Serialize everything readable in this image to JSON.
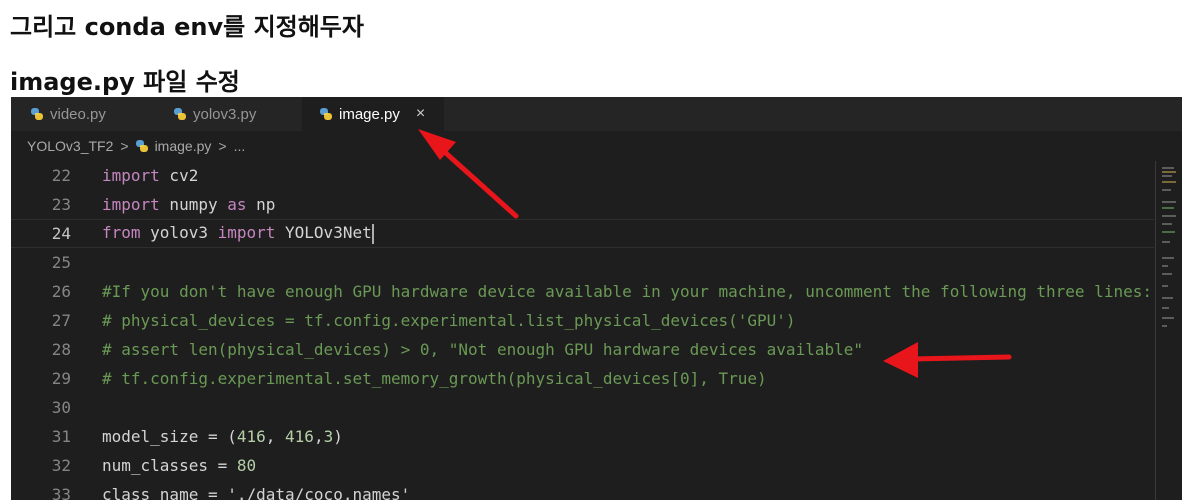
{
  "headings": {
    "first": "그리고 conda env를 지정해두자",
    "second": "image.py 파일 수정"
  },
  "editor": {
    "tabs": [
      {
        "label": "video.py",
        "active": false,
        "icon": "python-file-icon"
      },
      {
        "label": "yolov3.py",
        "active": false,
        "icon": "python-file-icon"
      },
      {
        "label": "image.py",
        "active": true,
        "icon": "python-file-icon",
        "close": "×"
      }
    ],
    "breadcrumb": {
      "folder": "YOLOv3_TF2",
      "separator": ">",
      "file": "image.py",
      "tail": "..."
    },
    "lines": [
      {
        "n": "22",
        "tokens": [
          {
            "t": "import",
            "c": "kw"
          },
          {
            "t": " cv2",
            "c": "id"
          }
        ]
      },
      {
        "n": "23",
        "tokens": [
          {
            "t": "import",
            "c": "kw"
          },
          {
            "t": " numpy ",
            "c": "id"
          },
          {
            "t": "as",
            "c": "kw"
          },
          {
            "t": " np",
            "c": "id"
          }
        ]
      },
      {
        "n": "24",
        "tokens": [
          {
            "t": "from",
            "c": "kw"
          },
          {
            "t": " yolov3 ",
            "c": "id"
          },
          {
            "t": "import",
            "c": "kw"
          },
          {
            "t": " YOLOv3Net",
            "c": "id"
          }
        ],
        "cursor": true
      },
      {
        "n": "25",
        "tokens": []
      },
      {
        "n": "26",
        "tokens": [
          {
            "t": "#If you don't have enough GPU hardware device available in your machine, uncomment the following three lines:",
            "c": "cmt"
          }
        ]
      },
      {
        "n": "27",
        "tokens": [
          {
            "t": "# physical_devices = tf.config.experimental.list_physical_devices('GPU')",
            "c": "cmt"
          }
        ]
      },
      {
        "n": "28",
        "tokens": [
          {
            "t": "# assert len(physical_devices) > 0, \"Not enough GPU hardware devices available\"",
            "c": "cmt"
          }
        ]
      },
      {
        "n": "29",
        "tokens": [
          {
            "t": "# tf.config.experimental.set_memory_growth(physical_devices[0], True)",
            "c": "cmt"
          }
        ]
      },
      {
        "n": "30",
        "tokens": []
      },
      {
        "n": "31",
        "tokens": [
          {
            "t": "model_size = (",
            "c": "id"
          },
          {
            "t": "416",
            "c": "num"
          },
          {
            "t": ", ",
            "c": "id"
          },
          {
            "t": "416",
            "c": "num"
          },
          {
            "t": ",",
            "c": "id"
          },
          {
            "t": "3",
            "c": "num"
          },
          {
            "t": ")",
            "c": "id"
          }
        ]
      },
      {
        "n": "32",
        "tokens": [
          {
            "t": "num_classes = ",
            "c": "id"
          },
          {
            "t": "80",
            "c": "num"
          }
        ]
      },
      {
        "n": "33",
        "tokens": [
          {
            "t": "class_name = './data/coco.names'",
            "c": "id"
          }
        ]
      }
    ]
  },
  "annotation_color": "#e8151b"
}
